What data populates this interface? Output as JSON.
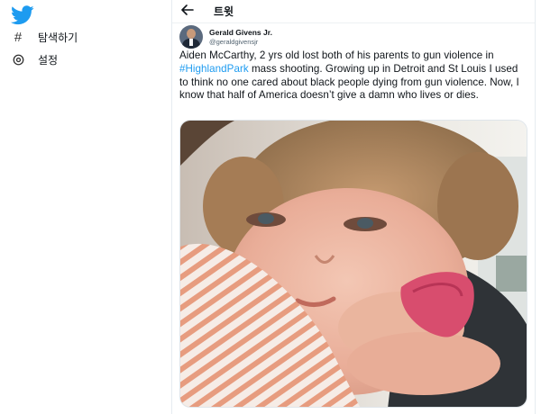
{
  "sidebar": {
    "logo_icon": "twitter-bird-icon",
    "items": [
      {
        "label": "탐색하기",
        "icon": "hash-icon"
      },
      {
        "label": "설정",
        "icon": "gear-icon"
      }
    ]
  },
  "header": {
    "back_icon": "arrow-left-icon",
    "title": "트윗"
  },
  "tweet": {
    "author": {
      "name": "Gerald Givens Jr.",
      "handle": "@geraldgivensjr"
    },
    "text_before": "Aiden McCarthy, 2 yrs old lost both of his parents to gun violence in ",
    "hashtag": "#HighlandPark",
    "text_after": " mass shooting. Growing up in Detroit and St Louis I used to think no one cared about black people dying from gun violence. Now, I know that half of America doesn’t give a damn who lives or dies.",
    "media": "photo of a toddler resting on an adult's shoulder holding a pink cloth"
  },
  "colors": {
    "brand": "#1d9bf0",
    "text": "#0f1419",
    "secondary_text": "#536471",
    "divider": "#e6ecf0"
  }
}
